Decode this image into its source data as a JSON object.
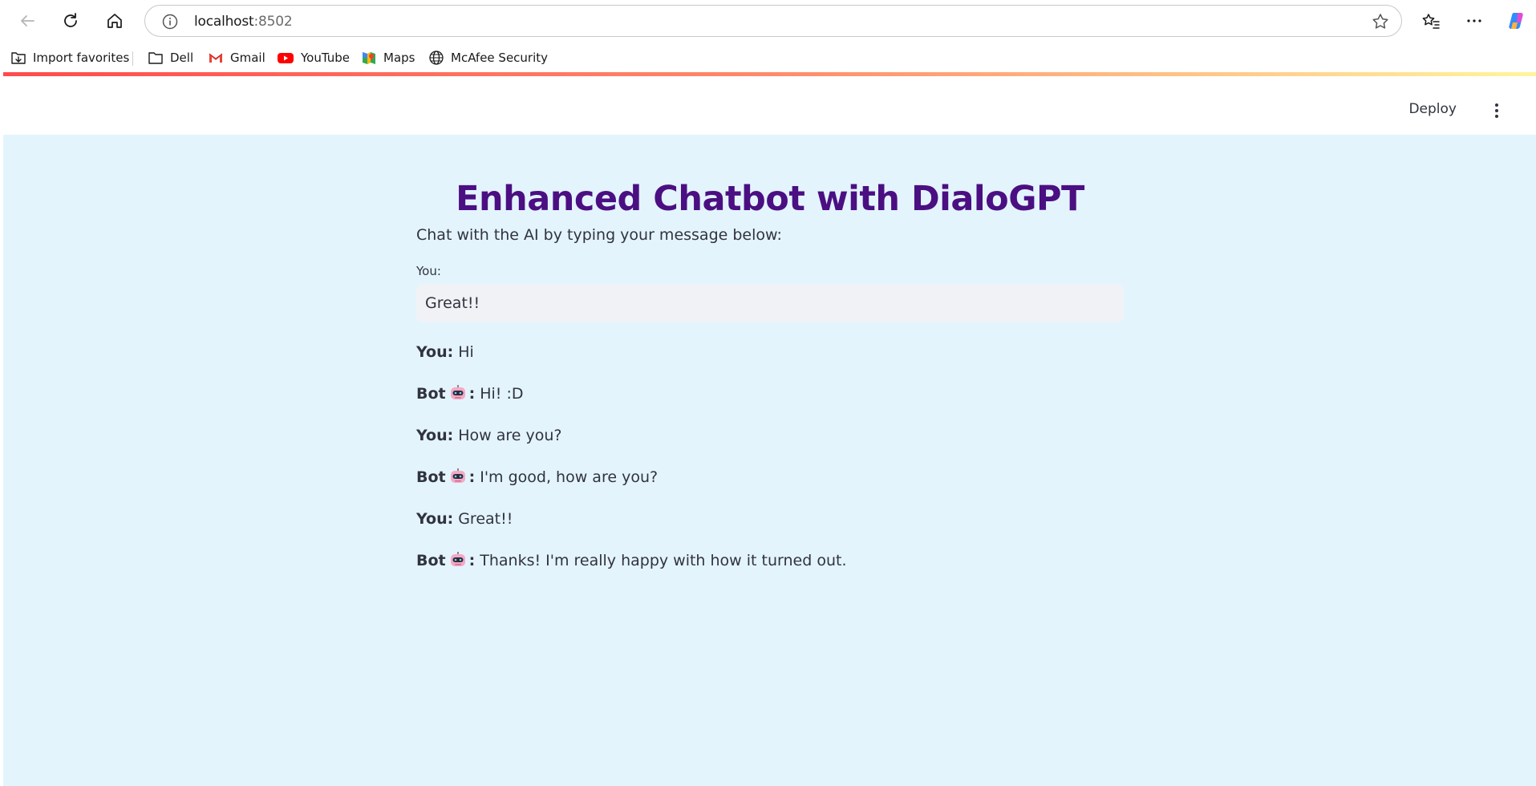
{
  "browser": {
    "url_host": "localhost",
    "url_port": ":8502",
    "bookmarks": [
      {
        "label": "Import favorites",
        "icon": "import-favorites-icon"
      },
      {
        "label": "Dell",
        "icon": "folder-icon"
      },
      {
        "label": "Gmail",
        "icon": "gmail-icon"
      },
      {
        "label": "YouTube",
        "icon": "youtube-icon"
      },
      {
        "label": "Maps",
        "icon": "maps-icon"
      },
      {
        "label": "McAfee Security",
        "icon": "globe-icon"
      }
    ]
  },
  "app": {
    "deploy_label": "Deploy",
    "title": "Enhanced Chatbot with DialoGPT",
    "subtitle": "Chat with the AI by typing your message below:",
    "input_label": "You:",
    "input_value": "Great!!",
    "messages": [
      {
        "speaker": "You:",
        "text": "Hi",
        "bot": false
      },
      {
        "speaker": "Bot",
        "text": "Hi! :D",
        "bot": true
      },
      {
        "speaker": "You:",
        "text": "How are you?",
        "bot": false
      },
      {
        "speaker": "Bot",
        "text": "I'm good, how are you?",
        "bot": true
      },
      {
        "speaker": "You:",
        "text": "Great!!",
        "bot": false
      },
      {
        "speaker": "Bot",
        "text": "Thanks! I'm really happy with how it turned out.",
        "bot": true
      }
    ]
  },
  "colors": {
    "page_background": "#e3f4fd",
    "title": "#4b0f82",
    "input_background": "#f0f2f6",
    "text": "#31333f"
  }
}
